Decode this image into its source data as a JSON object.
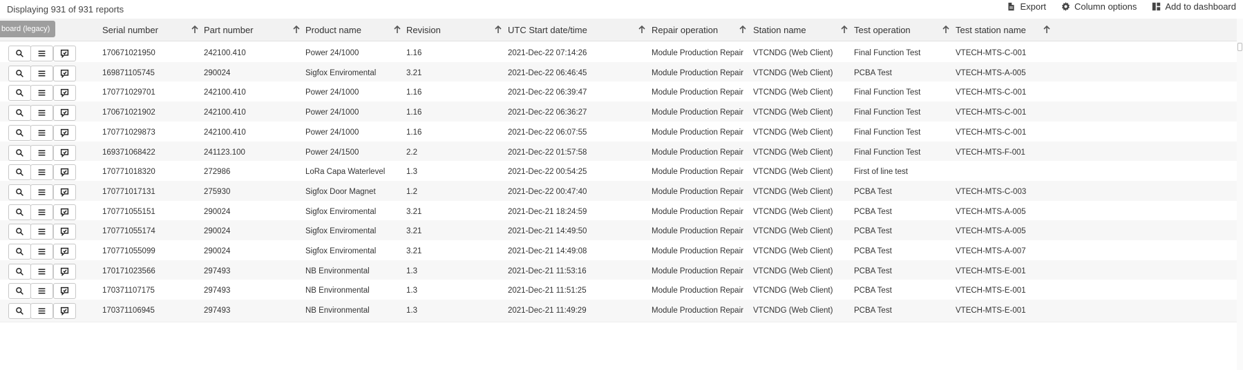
{
  "toolbar": {
    "count_text": "Displaying 931 of 931 reports",
    "export_label": "Export",
    "column_options_label": "Column options",
    "add_dashboard_label": "Add to dashboard"
  },
  "tooltip": "board (legacy)",
  "columns": [
    "Serial number",
    "Part number",
    "Product name",
    "Revision",
    "UTC Start date/time",
    "Repair operation",
    "Station name",
    "Test operation",
    "Test station name"
  ],
  "rows": [
    [
      "170671021950",
      "242100.410",
      "Power 24/1000",
      "1.16",
      "2021-Dec-22 07:14:26",
      "Module Production Repair",
      "VTCNDG (Web Client)",
      "Final Function Test",
      "VTECH-MTS-C-001"
    ],
    [
      "169871105745",
      "290024",
      "Sigfox Enviromental",
      "3.21",
      "2021-Dec-22 06:46:45",
      "Module Production Repair",
      "VTCNDG (Web Client)",
      "PCBA Test",
      "VTECH-MTS-A-005"
    ],
    [
      "170771029701",
      "242100.410",
      "Power 24/1000",
      "1.16",
      "2021-Dec-22 06:39:47",
      "Module Production Repair",
      "VTCNDG (Web Client)",
      "Final Function Test",
      "VTECH-MTS-C-001"
    ],
    [
      "170671021902",
      "242100.410",
      "Power 24/1000",
      "1.16",
      "2021-Dec-22 06:36:27",
      "Module Production Repair",
      "VTCNDG (Web Client)",
      "Final Function Test",
      "VTECH-MTS-C-001"
    ],
    [
      "170771029873",
      "242100.410",
      "Power 24/1000",
      "1.16",
      "2021-Dec-22 06:07:55",
      "Module Production Repair",
      "VTCNDG (Web Client)",
      "Final Function Test",
      "VTECH-MTS-C-001"
    ],
    [
      "169371068422",
      "241123.100",
      "Power 24/1500",
      "2.2",
      "2021-Dec-22 01:57:58",
      "Module Production Repair",
      "VTCNDG (Web Client)",
      "Final Function Test",
      "VTECH-MTS-F-001"
    ],
    [
      "170771018320",
      "272986",
      "LoRa Capa Waterlevel",
      "1.3",
      "2021-Dec-22 00:54:25",
      "Module Production Repair",
      "VTCNDG (Web Client)",
      "First of line test",
      ""
    ],
    [
      "170771017131",
      "275930",
      "Sigfox Door Magnet",
      "1.2",
      "2021-Dec-22 00:47:40",
      "Module Production Repair",
      "VTCNDG (Web Client)",
      "PCBA Test",
      "VTECH-MTS-C-003"
    ],
    [
      "170771055151",
      "290024",
      "Sigfox Enviromental",
      "3.21",
      "2021-Dec-21 18:24:59",
      "Module Production Repair",
      "VTCNDG (Web Client)",
      "PCBA Test",
      "VTECH-MTS-A-005"
    ],
    [
      "170771055174",
      "290024",
      "Sigfox Enviromental",
      "3.21",
      "2021-Dec-21 14:49:50",
      "Module Production Repair",
      "VTCNDG (Web Client)",
      "PCBA Test",
      "VTECH-MTS-A-005"
    ],
    [
      "170771055099",
      "290024",
      "Sigfox Enviromental",
      "3.21",
      "2021-Dec-21 14:49:08",
      "Module Production Repair",
      "VTCNDG (Web Client)",
      "PCBA Test",
      "VTECH-MTS-A-007"
    ],
    [
      "170171023566",
      "297493",
      "NB Environmental",
      "1.3",
      "2021-Dec-21 11:53:16",
      "Module Production Repair",
      "VTCNDG (Web Client)",
      "PCBA Test",
      "VTECH-MTS-E-001"
    ],
    [
      "170371107175",
      "297493",
      "NB Environmental",
      "1.3",
      "2021-Dec-21 11:51:25",
      "Module Production Repair",
      "VTCNDG (Web Client)",
      "PCBA Test",
      "VTECH-MTS-E-001"
    ],
    [
      "170371106945",
      "297493",
      "NB Environmental",
      "1.3",
      "2021-Dec-21 11:49:29",
      "Module Production Repair",
      "VTCNDG (Web Client)",
      "PCBA Test",
      "VTECH-MTS-E-001"
    ]
  ],
  "row_buttons": [
    "search-icon",
    "menu-icon",
    "chat-icon"
  ],
  "colors": {
    "header_bg": "#f2f2f2",
    "alt_row_bg": "#f7f7f7",
    "tooltip_bg": "#9e9e9e"
  }
}
